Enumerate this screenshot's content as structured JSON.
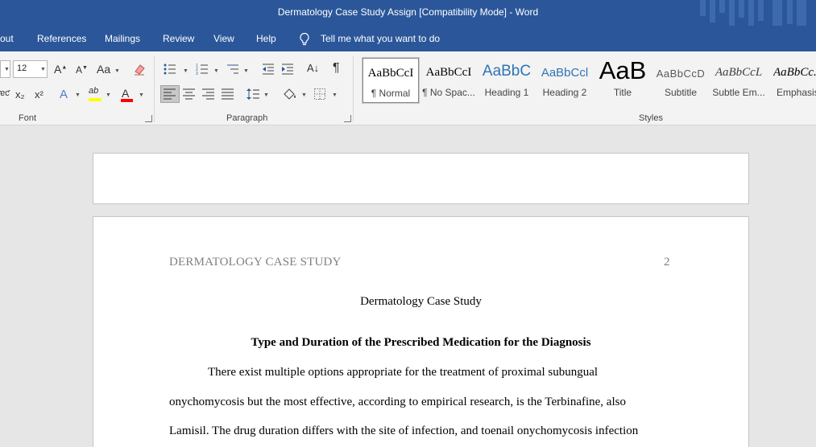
{
  "window": {
    "title": "Dermatology Case Study Assign [Compatibility Mode]  -  Word"
  },
  "menu": {
    "items": [
      "out",
      "References",
      "Mailings",
      "Review",
      "View",
      "Help"
    ],
    "tell_me": "Tell me what you want to do"
  },
  "ribbon": {
    "font": {
      "size": "12",
      "change_case": "Aa",
      "grow": "A",
      "shrink": "A",
      "subscript": "x₂",
      "superscript": "x²",
      "strike": "ɐƈ",
      "text_effects": "A",
      "highlight": "ab",
      "font_color": "A",
      "group_label": "Font"
    },
    "paragraph": {
      "sort": "A↓",
      "pilcrow": "¶",
      "group_label": "Paragraph"
    },
    "styles": {
      "group_label": "Styles",
      "tiles": [
        {
          "sample": "AaBbCcI",
          "name": "¶ Normal",
          "color": "#000000"
        },
        {
          "sample": "AaBbCcI",
          "name": "¶ No Spac...",
          "color": "#000000"
        },
        {
          "sample": "AaBbC",
          "name": "Heading 1",
          "color": "#2e74b5"
        },
        {
          "sample": "AaBbCcl",
          "name": "Heading 2",
          "color": "#2e74b5"
        },
        {
          "sample": "AaB",
          "name": "Title",
          "color": "#000000"
        },
        {
          "sample": "AaBbCcD",
          "name": "Subtitle",
          "color": "#595959"
        },
        {
          "sample": "AaBbCcL",
          "name": "Subtle Em...",
          "color": "#404040"
        },
        {
          "sample": "AaBbCc.",
          "name": "Emphasis",
          "color": "#000000"
        }
      ]
    }
  },
  "colors": {
    "accent": "#2b579a",
    "highlight_yellow": "#ffff00",
    "font_red": "#ff0000"
  },
  "document": {
    "header_left": "DERMATOLOGY CASE STUDY",
    "page_number": "2",
    "title": "Dermatology Case Study",
    "heading": "Type and Duration of the Prescribed Medication for the Diagnosis",
    "paragraph_lines": [
      "There exist multiple options appropriate for the treatment of proximal subungual",
      "onychomycosis but the most effective, according to empirical research, is the Terbinafine, also",
      "Lamisil. The drug duration differs with the site of infection, and toenail onychomycosis infection"
    ]
  }
}
